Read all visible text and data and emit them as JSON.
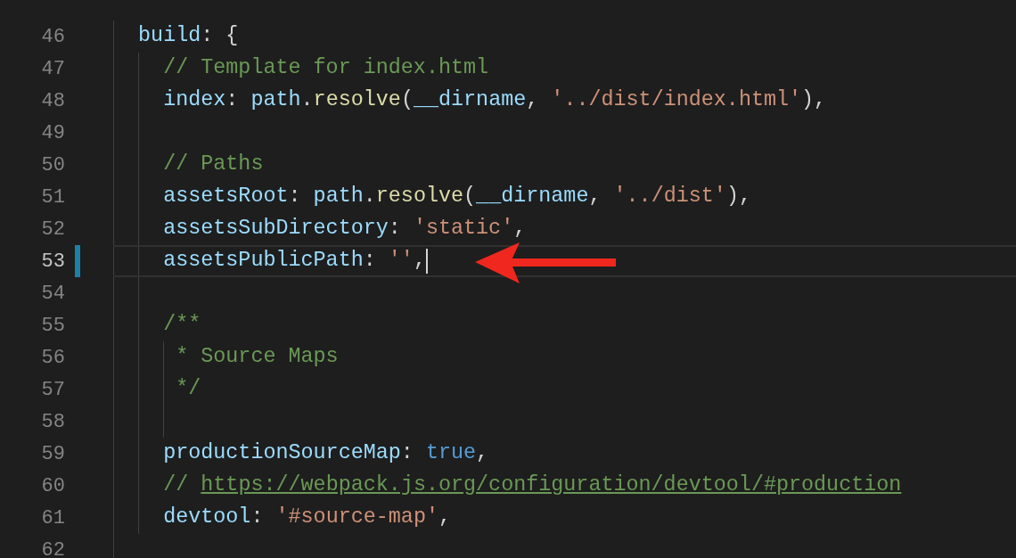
{
  "editor": {
    "lines": [
      {
        "number": "46",
        "current": false,
        "modified": false,
        "cursor": false,
        "tokens": [
          {
            "kind": "key",
            "text": "build"
          },
          {
            "kind": "punct",
            "text": ": {"
          }
        ],
        "children": [
          {
            "number": "47",
            "current": false,
            "modified": false,
            "cursor": false,
            "tokens": [
              {
                "kind": "comment",
                "text": "// Template for index.html"
              }
            ]
          },
          {
            "number": "48",
            "current": false,
            "modified": false,
            "cursor": false,
            "tokens": [
              {
                "kind": "key",
                "text": "index"
              },
              {
                "kind": "punct",
                "text": ": "
              },
              {
                "kind": "var",
                "text": "path"
              },
              {
                "kind": "punct",
                "text": "."
              },
              {
                "kind": "func",
                "text": "resolve"
              },
              {
                "kind": "punct",
                "text": "("
              },
              {
                "kind": "var",
                "text": "__dirname"
              },
              {
                "kind": "punct",
                "text": ", "
              },
              {
                "kind": "str",
                "text": "'../dist/index.html'"
              },
              {
                "kind": "punct",
                "text": "),"
              }
            ]
          },
          {
            "number": "49",
            "current": false,
            "modified": false,
            "cursor": false
          },
          {
            "number": "50",
            "current": false,
            "modified": false,
            "cursor": false,
            "tokens": [
              {
                "kind": "comment",
                "text": "// Paths"
              }
            ]
          },
          {
            "number": "51",
            "current": false,
            "modified": false,
            "cursor": false,
            "tokens": [
              {
                "kind": "key",
                "text": "assetsRoot"
              },
              {
                "kind": "punct",
                "text": ": "
              },
              {
                "kind": "var",
                "text": "path"
              },
              {
                "kind": "punct",
                "text": "."
              },
              {
                "kind": "func",
                "text": "resolve"
              },
              {
                "kind": "punct",
                "text": "("
              },
              {
                "kind": "var",
                "text": "__dirname"
              },
              {
                "kind": "punct",
                "text": ", "
              },
              {
                "kind": "str",
                "text": "'../dist'"
              },
              {
                "kind": "punct",
                "text": "),"
              }
            ]
          },
          {
            "number": "52",
            "current": false,
            "modified": false,
            "cursor": false,
            "tokens": [
              {
                "kind": "key",
                "text": "assetsSubDirectory"
              },
              {
                "kind": "punct",
                "text": ": "
              },
              {
                "kind": "str",
                "text": "'static'"
              },
              {
                "kind": "punct",
                "text": ","
              }
            ]
          },
          {
            "number": "53",
            "current": true,
            "modified": true,
            "cursor": true,
            "tokens": [
              {
                "kind": "key",
                "text": "assetsPublicPath"
              },
              {
                "kind": "punct",
                "text": ": "
              },
              {
                "kind": "str",
                "text": "''"
              },
              {
                "kind": "punct",
                "text": ","
              }
            ]
          },
          {
            "number": "54",
            "current": false,
            "modified": false,
            "cursor": false
          },
          {
            "number": "55",
            "current": false,
            "modified": false,
            "cursor": false,
            "tokens": [
              {
                "kind": "comment",
                "text": "/**"
              }
            ],
            "children": [
              {
                "number": "56",
                "current": false,
                "modified": false,
                "cursor": false,
                "tokens": [
                  {
                    "kind": "comment",
                    "text": "* Source Maps"
                  }
                ]
              },
              {
                "number": "57",
                "current": false,
                "modified": false,
                "cursor": false,
                "tokens": [
                  {
                    "kind": "comment",
                    "text": "*/"
                  }
                ]
              },
              {
                "number": "58",
                "current": false,
                "modified": false,
                "cursor": false
              }
            ]
          },
          {
            "number": "59",
            "current": false,
            "modified": false,
            "cursor": false,
            "tokens": [
              {
                "kind": "key",
                "text": "productionSourceMap"
              },
              {
                "kind": "punct",
                "text": ": "
              },
              {
                "kind": "bool",
                "text": "true"
              },
              {
                "kind": "punct",
                "text": ","
              }
            ]
          },
          {
            "number": "60",
            "current": false,
            "modified": false,
            "cursor": false,
            "tokens": [
              {
                "kind": "comment",
                "text": "// "
              },
              {
                "kind": "link",
                "text": "https://webpack.js.org/configuration/devtool/#production"
              }
            ]
          },
          {
            "number": "61",
            "current": false,
            "modified": false,
            "cursor": false,
            "tokens": [
              {
                "kind": "key",
                "text": "devtool"
              },
              {
                "kind": "punct",
                "text": ": "
              },
              {
                "kind": "str",
                "text": "'#source-map'"
              },
              {
                "kind": "punct",
                "text": ","
              }
            ]
          }
        ]
      },
      {
        "number": "62",
        "current": false,
        "modified": false,
        "cursor": false
      }
    ]
  }
}
